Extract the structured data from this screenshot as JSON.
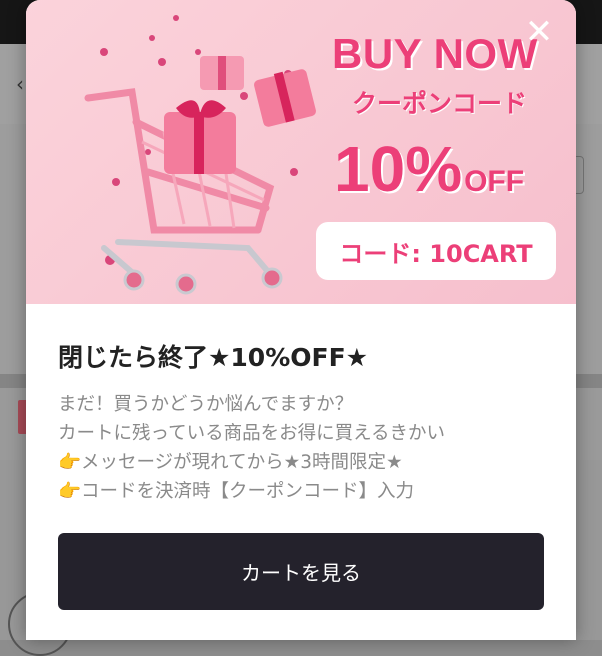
{
  "banner": {
    "headline": "BUY NOW",
    "subheadline": "クーポンコード",
    "discount_value": "10%",
    "discount_suffix": "OFF",
    "code_label": "コード: 10CART",
    "close_symbol": "✕",
    "accent_color": "#ec3f78"
  },
  "modal": {
    "title": "閉じたら終了★10%OFF★",
    "description": [
      {
        "icon": "",
        "text": "まだ！買うかどうか悩んでますか？"
      },
      {
        "icon": "",
        "text": "カートに残っている商品をお得に買えるきかい"
      },
      {
        "icon": "👉",
        "text": "メッセージが現れてから★3時間限定★"
      },
      {
        "icon": "👉",
        "text": "コードを決済時【クーポンコード】入力"
      }
    ],
    "cta_label": "カートを見る",
    "cta_color": "#24222c"
  }
}
